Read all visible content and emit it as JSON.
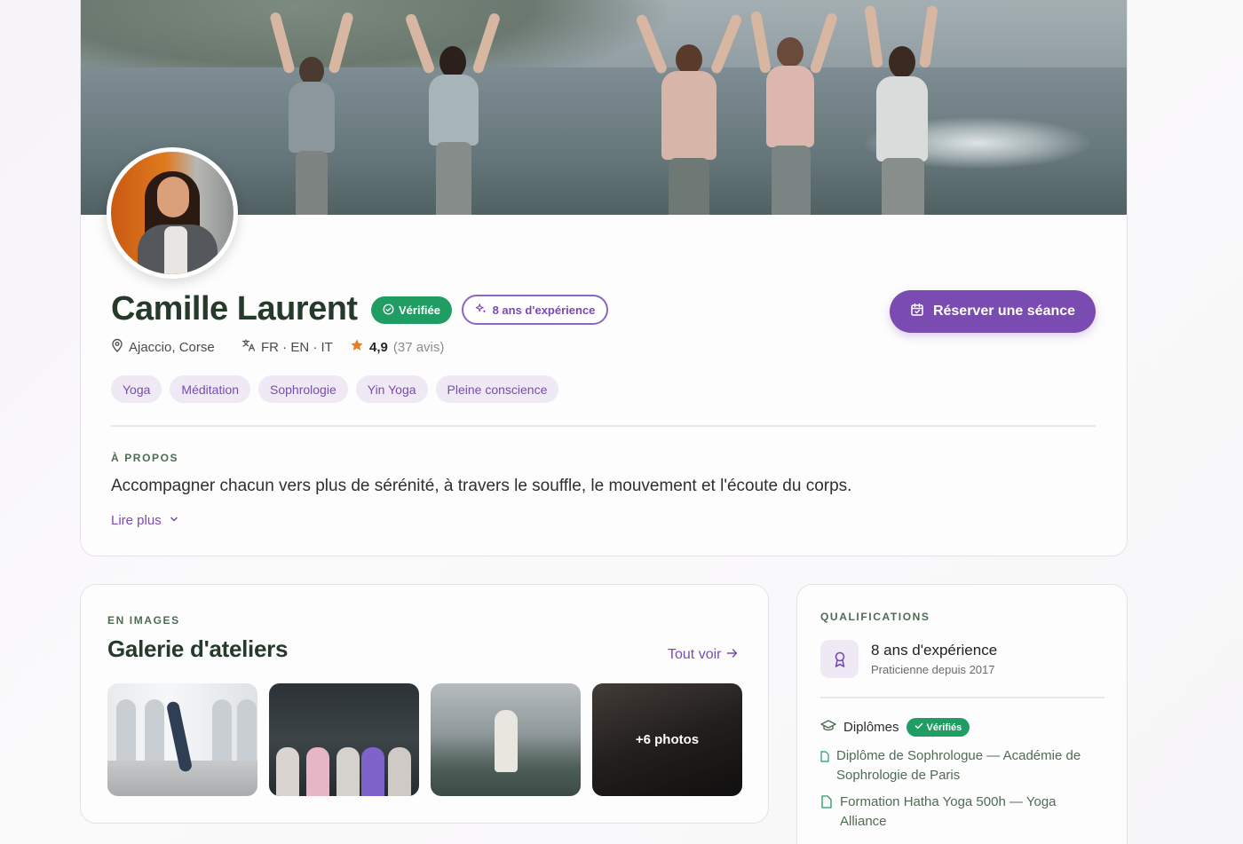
{
  "profile": {
    "name": "Camille Laurent",
    "verified_label": "Vérifiée",
    "experience_badge": "8 ans d'expérience",
    "location": "Ajaccio, Corse",
    "languages": "FR · EN · IT",
    "rating": "4,9",
    "reviews": "(37 avis)",
    "book_label": "Réserver une séance",
    "tags": [
      "Yoga",
      "Méditation",
      "Sophrologie",
      "Yin Yoga",
      "Pleine conscience"
    ],
    "about_label": "À PROPOS",
    "about_text": "Accompagner chacun vers plus de sérénité, à travers le souffle, le mouvement et l'écoute du corps.",
    "read_more": "Lire plus"
  },
  "gallery": {
    "eyebrow": "EN IMAGES",
    "title": "Galerie d'ateliers",
    "see_all": "Tout voir",
    "more_photos": "+6 photos"
  },
  "qualifications": {
    "eyebrow": "QUALIFICATIONS",
    "experience_title": "8 ans d'expérience",
    "experience_sub": "Praticienne depuis 2017",
    "diplomas_label": "Diplômes",
    "diplomas_badge": "Vérifiés",
    "diplomas": [
      "Diplôme de Sophrologue — Académie de Sophrologie de Paris",
      "Formation Hatha Yoga 500h — Yoga Alliance"
    ]
  },
  "colors": {
    "accent": "#7a4bb0",
    "verified": "#1f9d62",
    "heading": "#263a2b",
    "star": "#e67e22"
  },
  "icons": [
    "location-pin-icon",
    "translate-icon",
    "star-icon",
    "calendar-icon",
    "sparkles-icon",
    "check-circle-icon",
    "chevron-down-icon",
    "arrow-right-icon",
    "award-icon",
    "graduation-cap-icon",
    "document-icon"
  ]
}
